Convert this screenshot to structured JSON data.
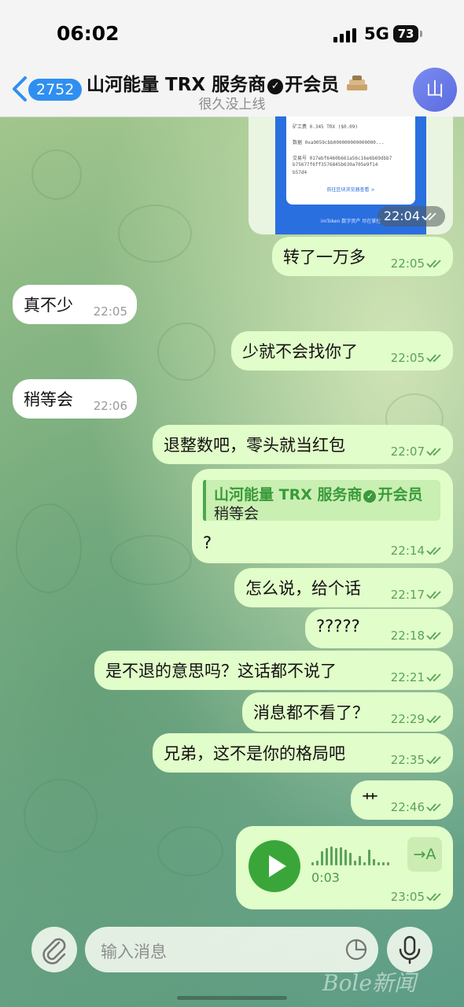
{
  "status_bar": {
    "time": "06:02",
    "network": "5G",
    "battery": "73"
  },
  "header": {
    "back_count": "2752",
    "title_part1": "山河能量 TRX 服务商",
    "title_part2": "开会员",
    "subtitle": "很久没上线",
    "avatar_initial": "山"
  },
  "screenshot_msg": {
    "time": "22:04",
    "rows": [
      "矿工费      0.345 TRX ($0.09)",
      "数据        0xa9059cbb000000000000000...",
      "交易号      017ebf6460b661a56c16e6b69dbb7",
      "            b75677f6ff3576845b630a705e9f14",
      "            b57d4"
    ],
    "link": "前往区块浏览器查看 >",
    "footer": "imToken  数字资产 尽在掌控"
  },
  "messages": [
    {
      "dir": "out",
      "text": "转了一万多",
      "time": "22:05"
    },
    {
      "dir": "in",
      "text": "真不少",
      "time": "22:05"
    },
    {
      "dir": "out",
      "text": "少就不会找你了",
      "time": "22:05"
    },
    {
      "dir": "in",
      "text": "稍等会",
      "time": "22:06"
    },
    {
      "dir": "out",
      "text": "退整数吧，零头就当红包",
      "time": "22:07"
    },
    {
      "dir": "out",
      "text": "?",
      "time": "22:14",
      "reply": {
        "name_part1": "山河能量 TRX 服务商",
        "name_part2": "开会员",
        "text": "稍等会"
      }
    },
    {
      "dir": "out",
      "text": "怎么说，给个话",
      "time": "22:17"
    },
    {
      "dir": "out",
      "text": "?????",
      "time": "22:18"
    },
    {
      "dir": "out",
      "text": "是不退的意思吗？这话都不说了",
      "time": "22:21"
    },
    {
      "dir": "out",
      "text": "消息都不看了？",
      "time": "22:29"
    },
    {
      "dir": "out",
      "text": "兄弟，这不是你的格局吧",
      "time": "22:35"
    },
    {
      "dir": "out",
      "text": "艹",
      "time": "22:46"
    }
  ],
  "voice_msg": {
    "duration": "0:03",
    "time": "23:05",
    "transcribe_label": "→A"
  },
  "composer": {
    "placeholder": "输入消息"
  },
  "watermark": "Bole新闻",
  "icons": {
    "back": "chevron-left-icon",
    "verified": "verified-badge-icon",
    "read": "double-check-icon",
    "play": "play-icon",
    "attach": "paperclip-icon",
    "sticker": "sticker-icon",
    "mic": "microphone-icon"
  },
  "colors": {
    "outgoing_bubble": "#e1fdc9",
    "incoming_bubble": "#ffffff",
    "accent_blue": "#2f8ff0",
    "accent_green": "#3aa63a"
  }
}
